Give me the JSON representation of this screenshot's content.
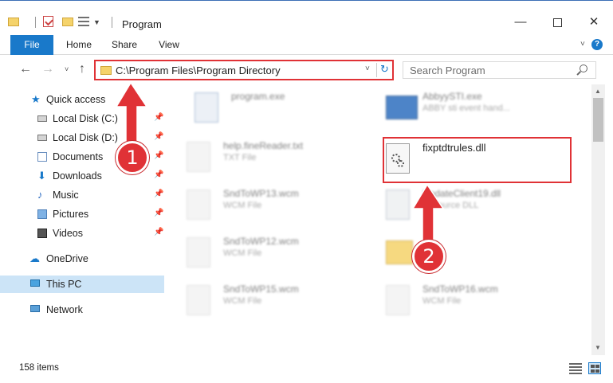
{
  "window": {
    "title": "Program",
    "controls": {
      "minimize": "—",
      "maximize": "",
      "close": "✕"
    }
  },
  "ribbon": {
    "tabs": [
      "File",
      "Home",
      "Share",
      "View"
    ]
  },
  "address": {
    "path": "C:\\Program Files\\Program Directory",
    "search_placeholder": "Search Program"
  },
  "sidebar": {
    "items": [
      {
        "label": "Quick access",
        "icon": "star-icon",
        "pinned": false
      },
      {
        "label": "Local Disk (C:)",
        "icon": "disk-icon",
        "pinned": true
      },
      {
        "label": "Local Disk (D:)",
        "icon": "disk-icon",
        "pinned": true
      },
      {
        "label": "Documents",
        "icon": "documents-icon",
        "pinned": true
      },
      {
        "label": "Downloads",
        "icon": "download-icon",
        "pinned": true
      },
      {
        "label": "Music",
        "icon": "music-icon",
        "pinned": true
      },
      {
        "label": "Pictures",
        "icon": "pictures-icon",
        "pinned": true
      },
      {
        "label": "Videos",
        "icon": "videos-icon",
        "pinned": true
      },
      {
        "label": "OneDrive",
        "icon": "cloud-icon",
        "pinned": false
      },
      {
        "label": "This PC",
        "icon": "pc-icon",
        "pinned": false,
        "selected": true
      },
      {
        "label": "Network",
        "icon": "network-icon",
        "pinned": false
      }
    ]
  },
  "files": {
    "items": [
      {
        "name": "program.exe",
        "type": ""
      },
      {
        "name": "AbbyySTI.exe",
        "type": "ABBY sti event hand..."
      },
      {
        "name": "help.fineReader.txt",
        "type": "TXT File"
      },
      {
        "name": "fixptdtrules.dll",
        "type": ""
      },
      {
        "name": "SndToWP13.wcm",
        "type": "WCM File"
      },
      {
        "name": "UpdateClient19.dll",
        "type": "Resource DLL"
      },
      {
        "name": "SndToWP12.wcm",
        "type": "WCM File"
      },
      {
        "name": "",
        "type": ""
      },
      {
        "name": "SndToWP15.wcm",
        "type": "WCM File"
      },
      {
        "name": "SndToWP16.wcm",
        "type": "WCM File"
      }
    ]
  },
  "annotations": {
    "step1": "1",
    "step2": "2"
  },
  "status": {
    "count": "158 items"
  },
  "colors": {
    "accent": "#1979ca",
    "highlight": "#e03236",
    "selected_bg": "#cce4f7"
  }
}
